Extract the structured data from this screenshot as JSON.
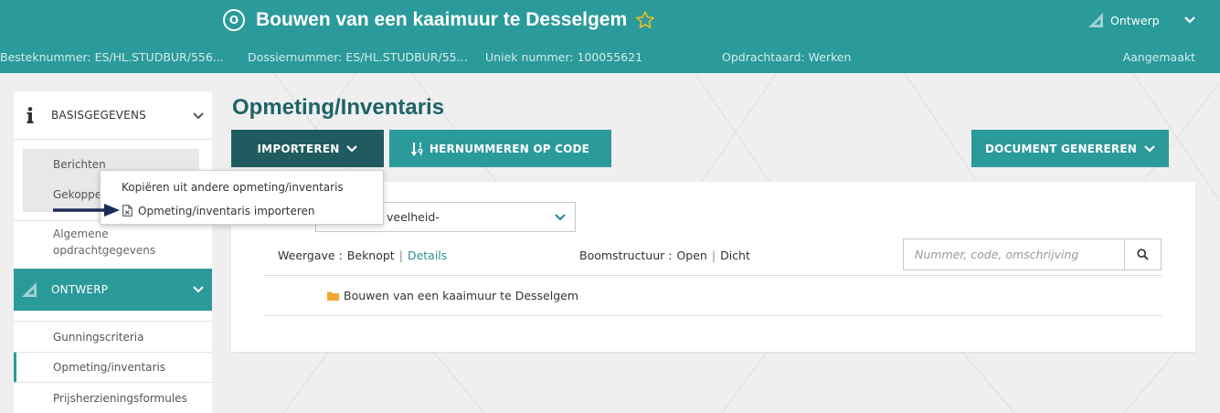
{
  "header": {
    "status_letter": "O",
    "title": "Bouwen van een kaaimuur te Desselgem",
    "phase": "Ontwerp",
    "besteknummer": "Besteknummer: ES/HL.STUDBUR/556...",
    "dossiernummer": "Dossiernummer: ES/HL.STUDBUR/55...",
    "uniek_nummer": "Uniek nummer: 100055621",
    "opdrachtaard": "Opdrachtaard: Werken",
    "status": "Aangemaakt"
  },
  "sidebar": {
    "basisgegevens": {
      "label": "BASISGEGEVENS",
      "items": [
        "Berichten",
        "Gekoppe",
        "Algemene opdrachtgegevens"
      ]
    },
    "ontwerp": {
      "label": "ONTWERP",
      "items": [
        "Gunningscriteria",
        "Opmeting/inventaris",
        "Prijsherzieningsformules"
      ],
      "active_index": 1
    }
  },
  "main": {
    "title": "Opmeting/Inventaris",
    "toolbar": {
      "import_label": "IMPORTEREN",
      "renumber_label": "HERNUMMEREN OP CODE",
      "generate_label": "DOCUMENT GENEREREN"
    },
    "import_menu": [
      "Kopiëren uit andere opmeting/inventaris",
      "Opmeting/inventaris importeren"
    ],
    "filter_select": "veelheid-",
    "view": {
      "weergave_label": "Weergave :",
      "beknopt": "Beknopt",
      "details": "Details",
      "boom_label": "Boomstructuur :",
      "open": "Open",
      "dicht": "Dicht",
      "separator": "|"
    },
    "search_placeholder": "Nummer, code, omschrijving",
    "tree_root": "Bouwen van een kaaimuur te Desselgem"
  },
  "icons": {
    "status": "circle-letter-icon",
    "favorite": "star-icon",
    "phase": "set-square-icon",
    "basisgegevens": "info-icon",
    "renumber": "sort-numeric-icon",
    "import_file": "document-icon",
    "tree_node": "folder-icon",
    "search": "search-icon",
    "annotation": "arrow-right-icon"
  },
  "colors": {
    "brand_teal": "#2b9a9b",
    "dark_teal": "#1f5b5f",
    "title_teal": "#1f6367",
    "link_teal": "#2b8e96",
    "star": "#f2c21a",
    "folder": "#f0a830",
    "annotation_arrow": "#1b2c5b",
    "background": "#efefef"
  }
}
